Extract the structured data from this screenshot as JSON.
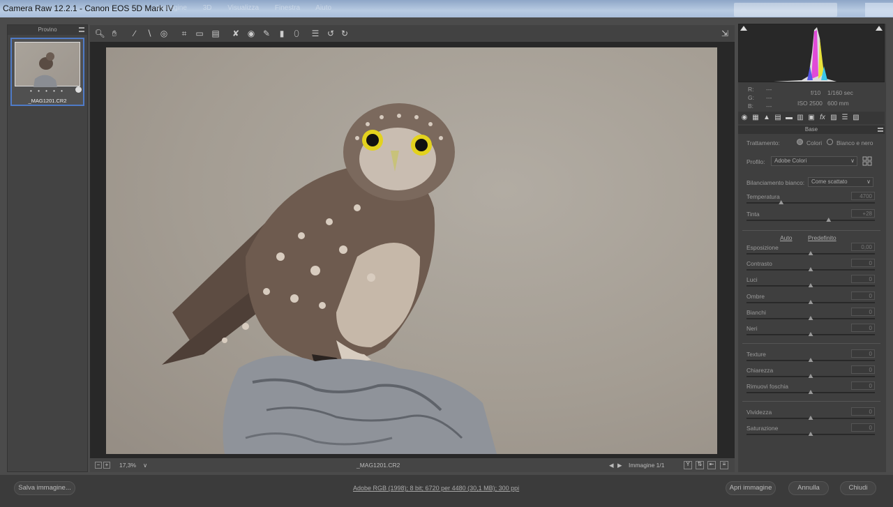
{
  "window": {
    "title": "Camera Raw 12.2.1  -  Canon EOS 5D Mark IV",
    "ghost_menu": [
      "Immagine",
      "3D",
      "Visualizza",
      "Finestra",
      "Aiuto"
    ]
  },
  "filmstrip": {
    "header": "Provino",
    "thumb_stars": "• • • • •",
    "thumb_name": "_MAG1201.CR2"
  },
  "statusbar": {
    "zoom": "17,3%",
    "filename": "_MAG1201.CR2",
    "image_counter": "Immagine 1/1",
    "y_label": "Y"
  },
  "readout": {
    "r_label": "R:",
    "g_label": "G:",
    "b_label": "B:",
    "r": "---",
    "g": "---",
    "b": "---",
    "aperture": "f/10",
    "shutter": "1/160 sec",
    "iso": "ISO 2500",
    "focal": "600 mm"
  },
  "panel": {
    "title": "Base",
    "treatment_label": "Trattamento:",
    "treatment_color": "Colori",
    "treatment_bw": "Bianco e nero",
    "profile_label": "Profilo:",
    "profile_value": "Adobe Colori",
    "wb_label": "Bilanciamento bianco:",
    "wb_value": "Come scattato",
    "auto": "Auto",
    "default": "Predefinito",
    "sliders": [
      {
        "label": "Temperatura",
        "value": "4700",
        "pos": 0.27
      },
      {
        "label": "Tinta",
        "value": "+28",
        "pos": 0.64
      },
      {
        "label": "Esposizione",
        "value": "0,00",
        "pos": 0.5
      },
      {
        "label": "Contrasto",
        "value": "0",
        "pos": 0.5
      },
      {
        "label": "Luci",
        "value": "0",
        "pos": 0.5
      },
      {
        "label": "Ombre",
        "value": "0",
        "pos": 0.5
      },
      {
        "label": "Bianchi",
        "value": "0",
        "pos": 0.5
      },
      {
        "label": "Neri",
        "value": "0",
        "pos": 0.5
      },
      {
        "label": "Texture",
        "value": "0",
        "pos": 0.5
      },
      {
        "label": "Chiarezza",
        "value": "0",
        "pos": 0.5
      },
      {
        "label": "Rimuovi foschia",
        "value": "0",
        "pos": 0.5
      },
      {
        "label": "Vividezza",
        "value": "0",
        "pos": 0.5
      },
      {
        "label": "Saturazione",
        "value": "0",
        "pos": 0.5
      }
    ]
  },
  "bottom": {
    "save": "Salva immagine...",
    "info": "Adobe RGB (1998); 8 bit; 6720 per 4480 (30,1 MB); 300 ppi",
    "open": "Apri immagine",
    "cancel": "Annulla",
    "close": "Chiudi"
  },
  "colors": {
    "accent": "#4f7bc7"
  }
}
